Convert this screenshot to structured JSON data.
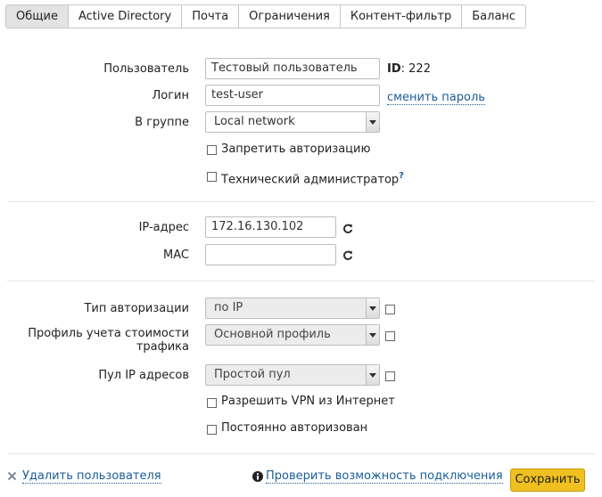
{
  "tabs": [
    "Общие",
    "Active Directory",
    "Почта",
    "Ограничения",
    "Контент-фильтр",
    "Баланс"
  ],
  "form": {
    "user_label": "Пользователь",
    "user_value": "Тестовый пользователь",
    "id_label": "ID",
    "id_value": ": 222",
    "login_label": "Логин",
    "login_value": "test-user",
    "change_password": "сменить пароль",
    "group_label": "В группе",
    "group_value": "Local network",
    "deny_auth": "Запретить авторизацию",
    "tech_admin": "Технический администратор",
    "help_mark": "?",
    "ip_label": "IP-адрес",
    "ip_value": "172.16.130.102",
    "mac_label": "MAC",
    "mac_value": "",
    "auth_type_label": "Тип авторизации",
    "auth_type_value": "по IP",
    "traffic_profile_label": "Профиль учета стоимости трафика",
    "traffic_profile_value": "Основной профиль",
    "ip_pool_label": "Пул IP адресов",
    "ip_pool_value": "Простой пул",
    "allow_vpn": "Разрешить VPN из Интернет",
    "always_auth": "Постоянно авторизован"
  },
  "footer": {
    "delete_user": "Удалить пользователя",
    "check_connection": "Проверить возможность подключения",
    "save": "Сохранить"
  },
  "colors": {
    "accent": "#f0c020",
    "link": "#1b5d98"
  }
}
